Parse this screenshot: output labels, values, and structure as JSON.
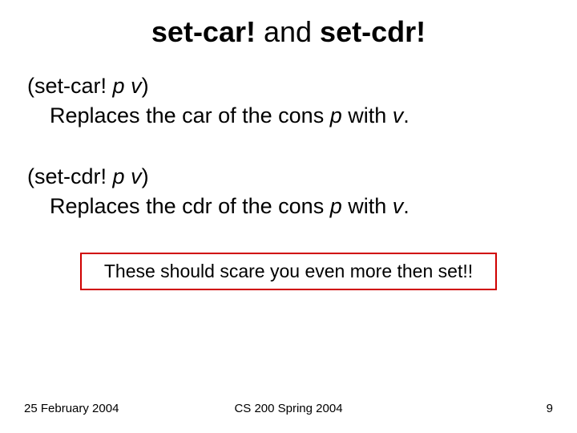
{
  "title": {
    "part1": "set-car!",
    "conj": " and ",
    "part2": "set-cdr!"
  },
  "car": {
    "open": "(set-car! ",
    "p": "p",
    "sp": " ",
    "v": "v",
    "close": ")",
    "desc_pre": "Replaces the car of the cons ",
    "desc_p": "p",
    "desc_with": " with ",
    "desc_v": "v",
    "desc_end": "."
  },
  "cdr": {
    "open": "(set-cdr! ",
    "p": "p",
    "sp": " ",
    "v": "v",
    "close": ")",
    "desc_pre": "Replaces the cdr of the cons ",
    "desc_p": "p",
    "desc_with": " with ",
    "desc_v": "v",
    "desc_end": "."
  },
  "warning": "These should scare you even more then set!!",
  "footer": {
    "date": "25 February 2004",
    "course": "CS 200 Spring 2004",
    "page": "9"
  }
}
